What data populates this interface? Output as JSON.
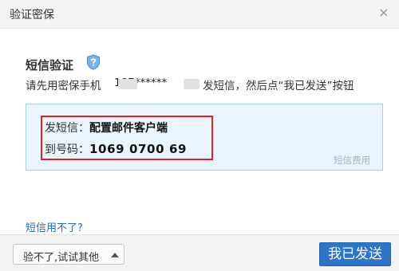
{
  "dialog": {
    "title": "验证密保",
    "close_glyph": "×"
  },
  "sms_verify": {
    "heading": "短信验证",
    "icon": "shield-question-icon",
    "instruction_prefix": "请先用密保手机",
    "phone_masked": "187******",
    "instruction_suffix": "发短信，然后点“我已发送”按钮",
    "message_label": "发短信：",
    "message_value": "配置邮件客户端",
    "number_label": "到号码：",
    "number_value": "1069 0700 69",
    "fee_note": "短信费用"
  },
  "help_link": "短信用不了?",
  "footer": {
    "other_button": "验不了,试试其他",
    "other_button_icon": "caret-up-icon",
    "send_button": "我已发送"
  },
  "colors": {
    "accent_blue": "#2e74c7",
    "highlight_red": "#e02020",
    "panel_bg": "#eaf4fc",
    "link": "#2b6bb6"
  }
}
